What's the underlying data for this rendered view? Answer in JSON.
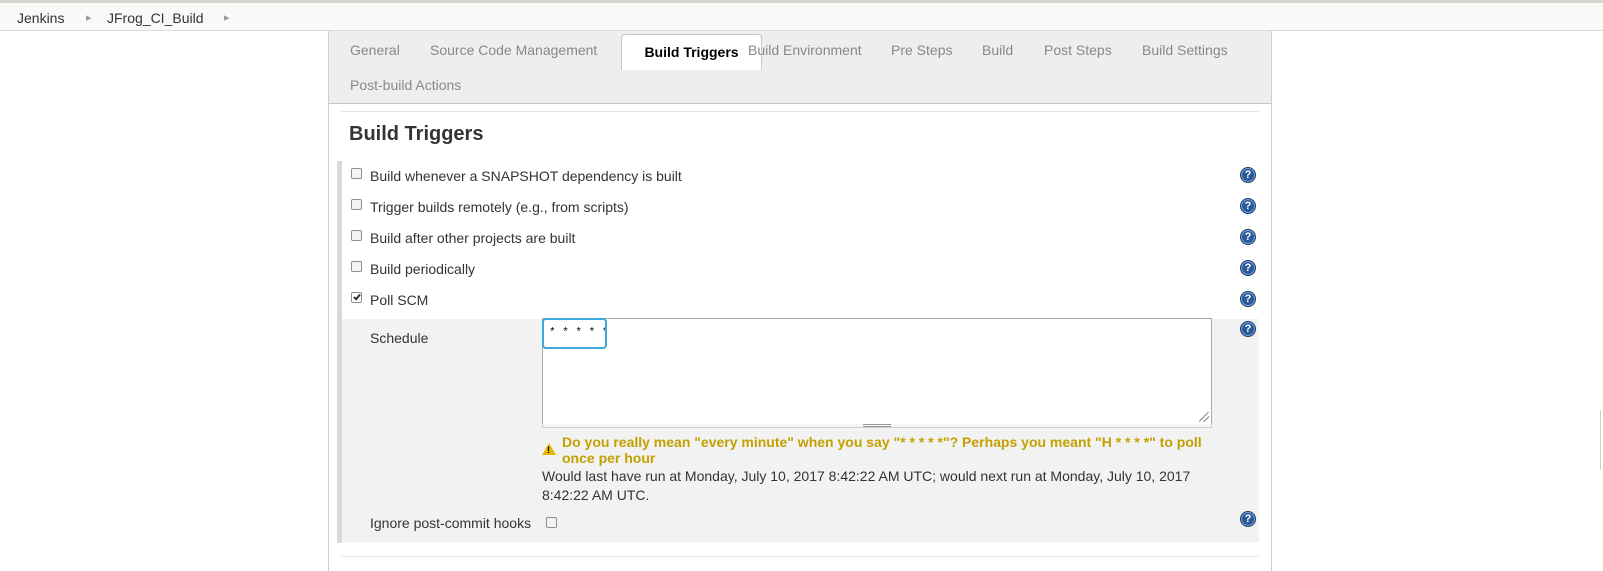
{
  "breadcrumb": {
    "items": [
      "Jenkins",
      "JFrog_CI_Build"
    ]
  },
  "tabs": {
    "general": "General",
    "scm": "Source Code Management",
    "triggers": "Build Triggers",
    "environment": "Build Environment",
    "pre_steps": "Pre Steps",
    "build": "Build",
    "post_steps": "Post Steps",
    "settings": "Build Settings",
    "post_build": "Post-build Actions",
    "active": "Build Triggers"
  },
  "section": {
    "title": "Build Triggers"
  },
  "triggers": [
    {
      "label": "Build whenever a SNAPSHOT dependency is built",
      "checked": false
    },
    {
      "label": "Trigger builds remotely (e.g., from scripts)",
      "checked": false
    },
    {
      "label": "Build after other projects are built",
      "checked": false
    },
    {
      "label": "Build periodically",
      "checked": false
    },
    {
      "label": "Poll SCM",
      "checked": true
    }
  ],
  "poll_scm": {
    "schedule_label": "Schedule",
    "schedule_value": "* * * * *",
    "warning": "Do you really mean \"every minute\" when you say \"* * * * *\"? Perhaps you meant \"H * * * *\" to poll once per hour",
    "info": "Would last have run at Monday, July 10, 2017 8:42:22 AM UTC; would next run at Monday, July 10, 2017 8:42:22 AM UTC.",
    "ignore_hooks_label": "Ignore post-commit hooks",
    "ignore_hooks_checked": false
  },
  "icons": {
    "help": "help-icon",
    "warning": "warning-icon"
  },
  "colors": {
    "warning": "#c4a000",
    "focus": "#3ea8dc",
    "help": "#2a5a9a"
  }
}
